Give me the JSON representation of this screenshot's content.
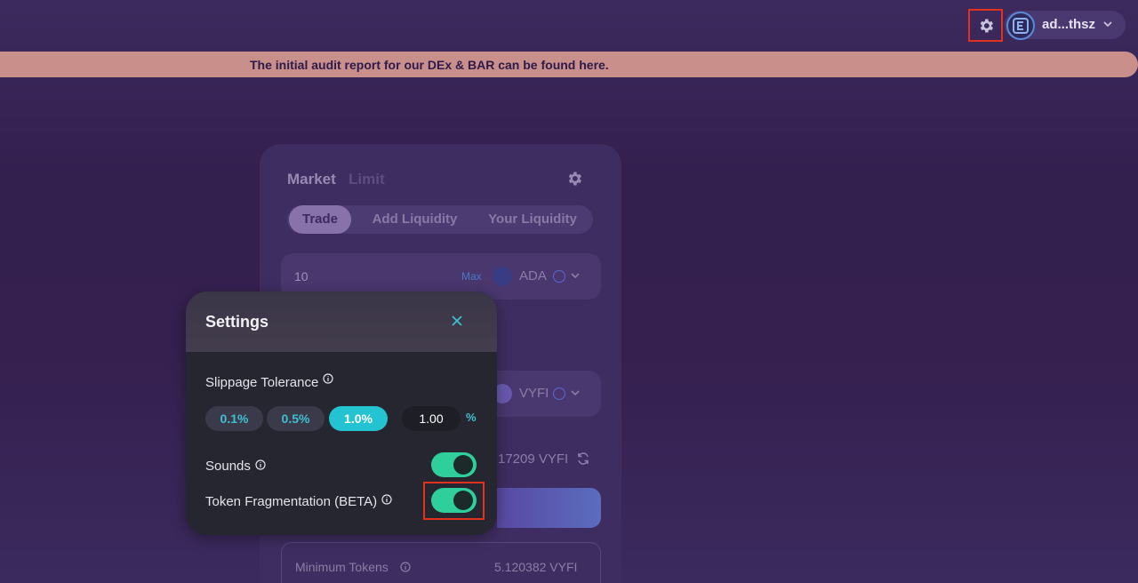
{
  "header": {
    "account_name": "ad...thsz",
    "icons": [
      "gear-icon",
      "wallet-logo-icon",
      "chevron-down-icon"
    ]
  },
  "banner": {
    "text": "The initial audit report for our DEx & BAR can be found here."
  },
  "swap_card": {
    "mode_tabs": [
      "Market",
      "Limit"
    ],
    "active_mode": "Market",
    "tabs": [
      {
        "label": "Trade",
        "active": true
      },
      {
        "label": "Add Liquidity",
        "active": false
      },
      {
        "label": "Your Liquidity",
        "active": false
      }
    ],
    "from": {
      "amount": "10",
      "max_label": "Max",
      "token": "ADA"
    },
    "to": {
      "token": "VYFI"
    },
    "rate_text": "17209 VYFI",
    "minimum_tokens": {
      "label": "Minimum Tokens",
      "value": "5.120382 VYFI"
    }
  },
  "settings": {
    "title": "Settings",
    "slippage": {
      "label": "Slippage Tolerance",
      "options": [
        {
          "label": "0.1%",
          "selected": false
        },
        {
          "label": "0.5%",
          "selected": false
        },
        {
          "label": "1.0%",
          "selected": true
        }
      ],
      "custom_value": "1.00",
      "unit": "%"
    },
    "sounds": {
      "label": "Sounds",
      "enabled": true
    },
    "fragmentation": {
      "label": "Token Fragmentation (BETA)",
      "enabled": true
    }
  },
  "colors": {
    "accent_cyan": "#23c3d1",
    "toggle_on": "#2fcf9c",
    "highlight": "#e0321c",
    "banner": "#c98f8a"
  }
}
